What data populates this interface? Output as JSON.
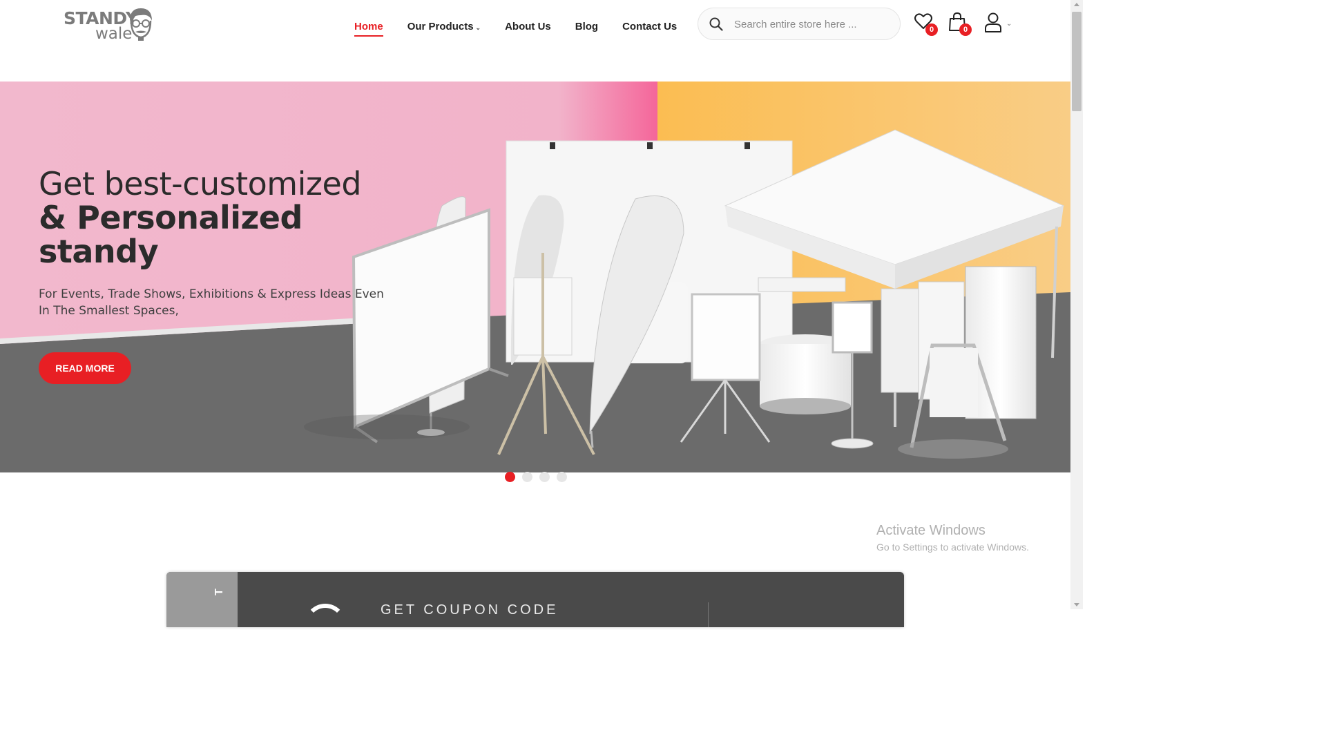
{
  "brand": {
    "line1": "STANDY",
    "line2": "wale"
  },
  "nav": {
    "items": [
      {
        "label": "Home"
      },
      {
        "label": "Our Products"
      },
      {
        "label": "About Us"
      },
      {
        "label": "Blog"
      },
      {
        "label": "Contact Us"
      }
    ]
  },
  "search": {
    "placeholder": "Search entire store here ..."
  },
  "header_icons": {
    "wishlist_count": "0",
    "cart_count": "0"
  },
  "hero": {
    "title_line1": "Get best-customized",
    "title_line2": "& Personalized",
    "title_line3": "standy",
    "subtitle": "For Events, Trade Shows, Exhibitions & Express Ideas Even In The Smallest Spaces,",
    "button": "READ MORE"
  },
  "carousel": {
    "active_slide": 1,
    "slide_count": 4
  },
  "watermark": {
    "title": "Activate Windows",
    "subtitle": "Go to Settings to activate Windows."
  },
  "coupon": {
    "text": "GET COUPON CODE",
    "side_text": "T"
  },
  "colors": {
    "accent": "#e81f24",
    "hero_pink": "#f2b8cd",
    "hero_yellow": "#f8c97a",
    "floor": "#6b6b6b"
  }
}
